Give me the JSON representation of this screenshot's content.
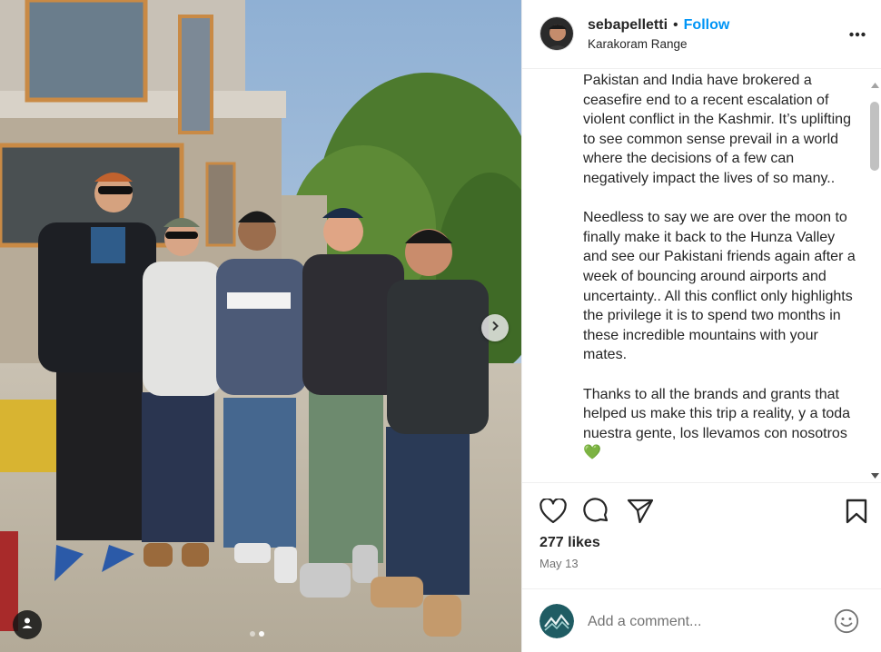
{
  "post": {
    "username": "sebapelletti",
    "separator": "•",
    "follow_label": "Follow",
    "location": "Karakoram Range",
    "caption": [
      "Pakistan and India have brokered a ceasefire end to a recent escalation of violent conflict in the Kashmir. It’s uplifting to see common sense prevail in a world where the decisions of a few can negatively impact the lives of so many..",
      "Needless to say we are over the moon to finally make it back to the Hunza Valley and see our Pakistani friends again after a week of bouncing around airports and uncertainty.. All this conflict only highlights the privilege it is to spend two months in these incredible mountains with your mates.",
      "Thanks to all the brands and grants that helped us make this trip a reality, y a toda nuestra gente, los llevamos con nosotros 💚"
    ],
    "likes": "277 likes",
    "date": "May 13"
  },
  "photo": {
    "shirt_text": "INDUSROUTE"
  },
  "carousel": {
    "total": 2,
    "current": 2
  },
  "comment": {
    "placeholder": "Add a comment..."
  },
  "icons": {
    "more": "more-options-icon",
    "like": "heart-icon",
    "comment": "comment-icon",
    "share": "send-icon",
    "save": "bookmark-icon",
    "next": "chevron-right-icon",
    "tag": "person-icon",
    "emoji": "emoji-icon"
  },
  "colors": {
    "follow": "#0095f6",
    "text": "#262626",
    "muted": "#737373"
  }
}
